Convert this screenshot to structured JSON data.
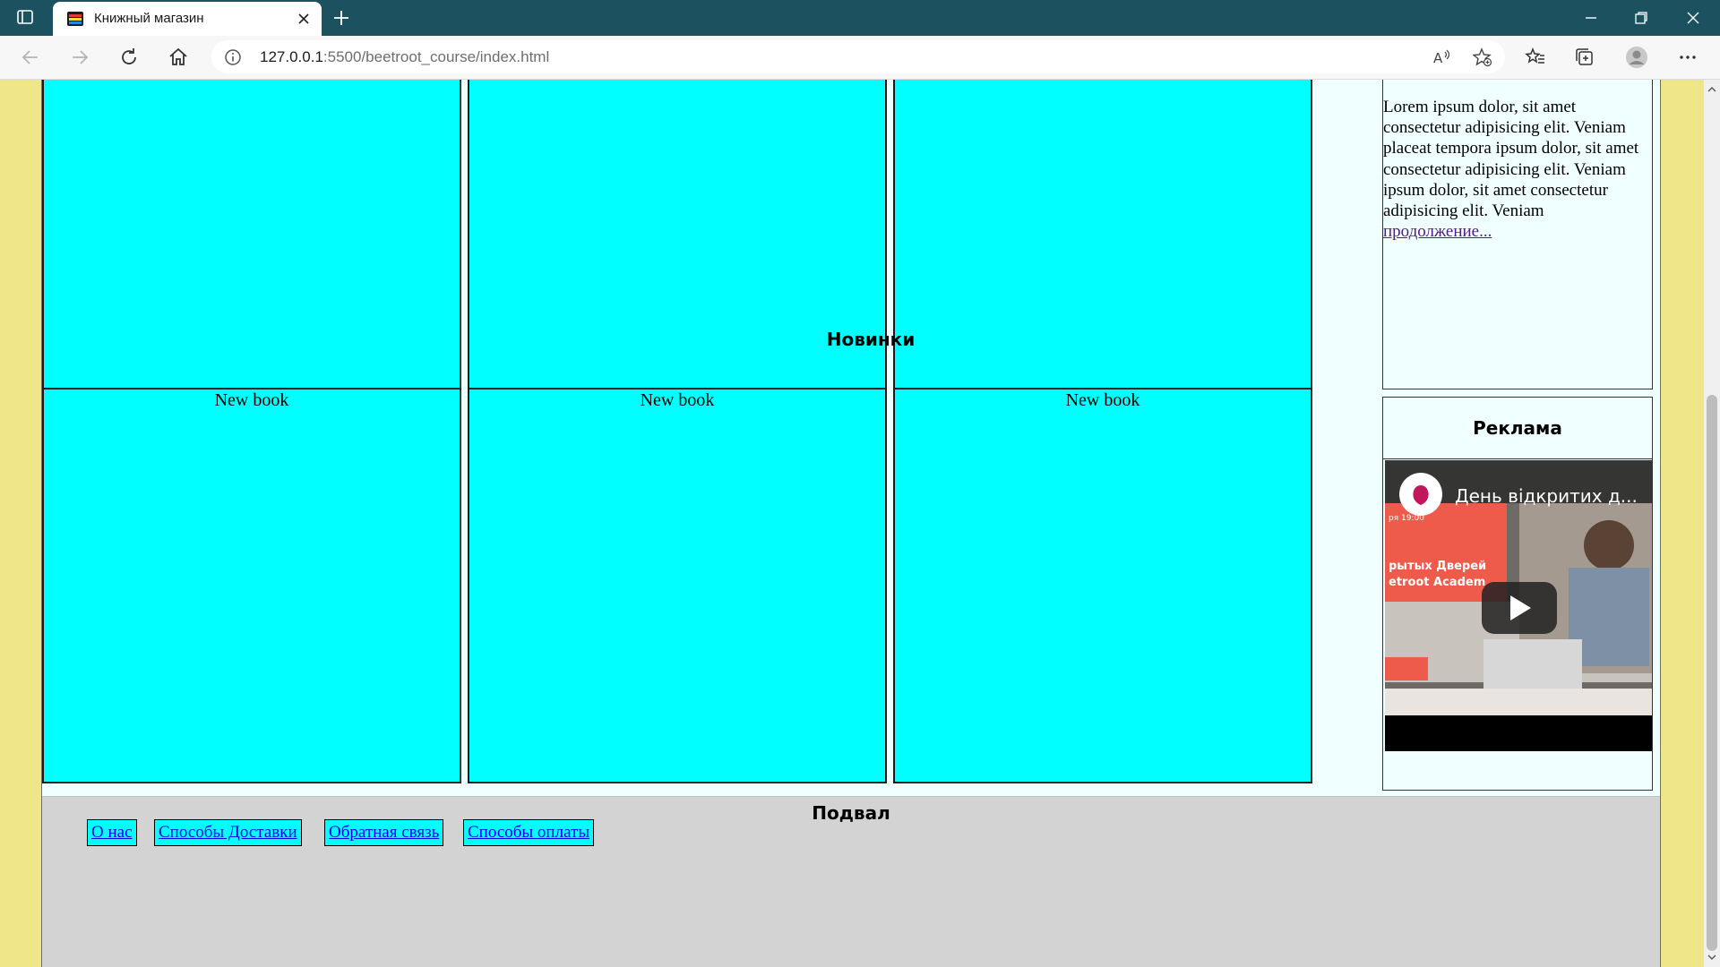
{
  "browser": {
    "tab_title": "Книжный магазин",
    "url_host": "127.0.0.1",
    "url_path": ":5500/beetroot_course/index.html"
  },
  "page": {
    "aside_text": "Lorem ipsum dolor, sit amet consectetur adipisicing elit. Veniam placeat tempora ipsum dolor, sit amet consectetur adipisicing elit. Veniam ipsum dolor, sit amet consectetur adipisicing elit. Veniam",
    "aside_link": "продолжение...",
    "new_section_title": "Новинки",
    "new_books": [
      "New book",
      "New book",
      "New book"
    ],
    "ad_title": "Реклама",
    "video_title": "День відкритих д...",
    "footer_title": "Подвал",
    "footer_links": [
      "О нас",
      "Способы Доставки",
      "Обратная связь",
      "Способы оплаты"
    ]
  },
  "colors": {
    "page_bg": "#efe589",
    "content_bg": "#f0ffff",
    "book_bg": "#00ffff",
    "footer_bg": "#d3d3d3",
    "tabbar_bg": "#1c5260"
  }
}
